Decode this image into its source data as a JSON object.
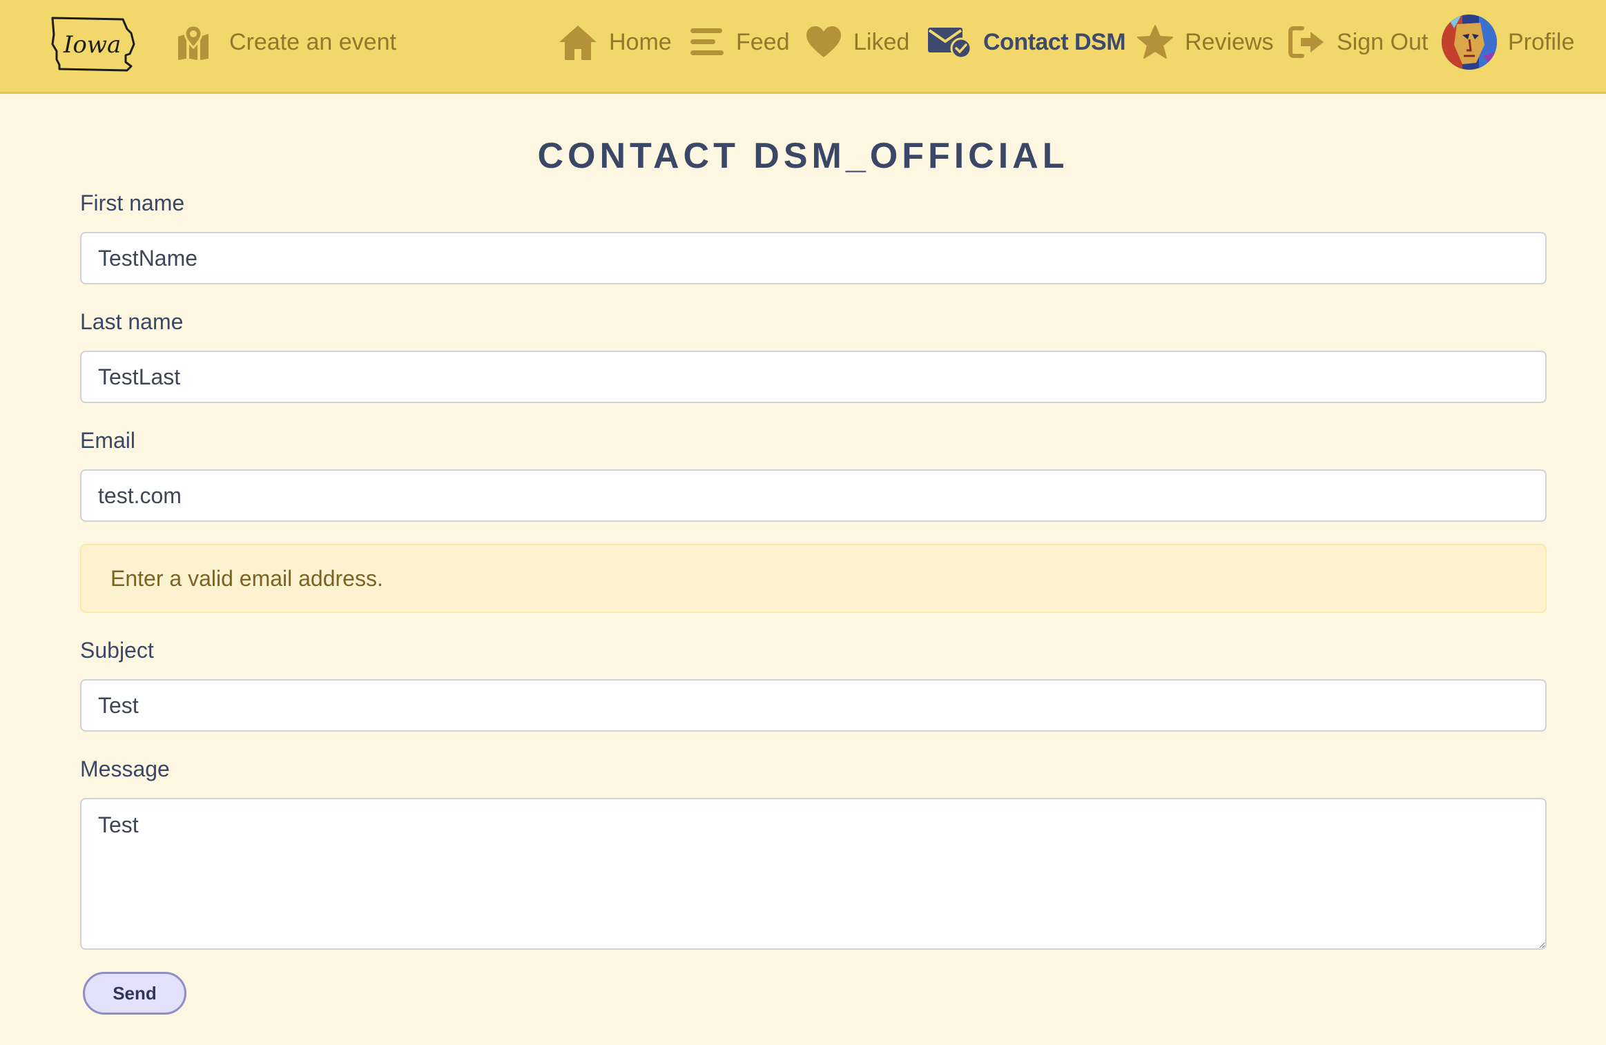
{
  "nav": {
    "logo_text": "Iowa",
    "create_event": "Create an event",
    "home": "Home",
    "feed": "Feed",
    "liked": "Liked",
    "contact": "Contact DSM",
    "reviews": "Reviews",
    "sign_out": "Sign Out",
    "profile": "Profile",
    "active_item": "Contact DSM"
  },
  "page": {
    "title": "CONTACT DSM_OFFICIAL"
  },
  "form": {
    "first_name_label": "First name",
    "first_name_value": "TestName",
    "last_name_label": "Last name",
    "last_name_value": "TestLast",
    "email_label": "Email",
    "email_value": "test.com",
    "email_error": "Enter a valid email address.",
    "subject_label": "Subject",
    "subject_value": "Test",
    "message_label": "Message",
    "message_value": "Test",
    "send_label": "Send"
  },
  "icons": {
    "map": "map-pin-icon",
    "home": "house-icon",
    "feed": "bars-icon",
    "liked": "heart-icon",
    "contact": "envelope-check-icon",
    "reviews": "star-icon",
    "sign_out": "sign-out-icon"
  },
  "colors": {
    "navbar_bg": "#f2d86a",
    "page_bg": "#fdf7e2",
    "nav_text": "#93782c",
    "nav_active": "#3d4a6e",
    "heading": "#3a4767",
    "alert_bg": "#fcf2cf",
    "alert_text": "#7a6324",
    "button_bg": "#e3e1fb",
    "button_border": "#8e8fc2"
  }
}
